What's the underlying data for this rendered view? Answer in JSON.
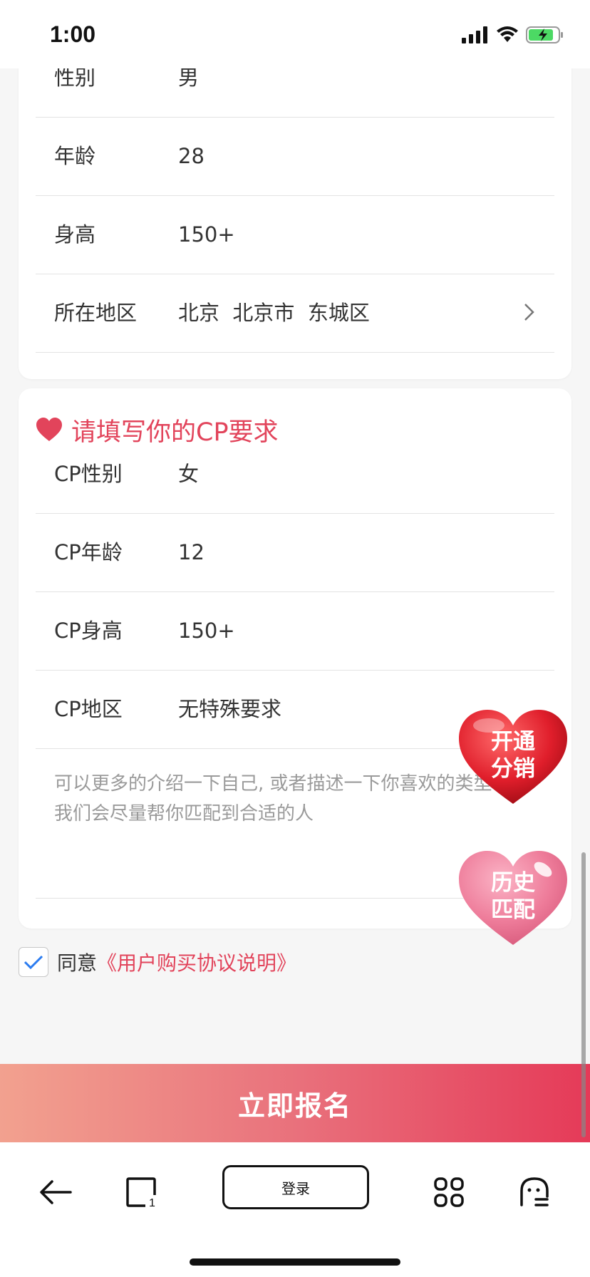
{
  "status_bar": {
    "time": "1:00"
  },
  "profile": {
    "rows": [
      {
        "label": "性别",
        "value": "男"
      },
      {
        "label": "年龄",
        "value": "28"
      },
      {
        "label": "身高",
        "value": "150+"
      },
      {
        "label": "所在地区",
        "value": "北京  北京市  东城区"
      }
    ]
  },
  "cp_section": {
    "title": "请填写你的CP要求",
    "rows": [
      {
        "label": "CP性别",
        "value": "女"
      },
      {
        "label": "CP年龄",
        "value": "12"
      },
      {
        "label": "CP身高",
        "value": "150+"
      },
      {
        "label": "CP地区",
        "value": "无特殊要求"
      }
    ],
    "textarea_placeholder": "可以更多的介绍一下自己, 或者描述一下你喜欢的类型\n我们会尽量帮你匹配到合适的人"
  },
  "floating": {
    "distribution": "开通\n分销",
    "history": "历史\n匹配"
  },
  "agreement": {
    "prefix": "同意",
    "link": "《用户购买协议说明》",
    "checked": true
  },
  "submit_label": "立即报名",
  "bottom_nav": {
    "login_label": "登录",
    "icons": [
      "back-arrow-icon",
      "tabs-icon",
      "grid-icon",
      "ghost-icon"
    ]
  },
  "colors": {
    "accent": "#e2445b",
    "gradient_start": "#f2a18f",
    "gradient_end": "#e53a58"
  }
}
